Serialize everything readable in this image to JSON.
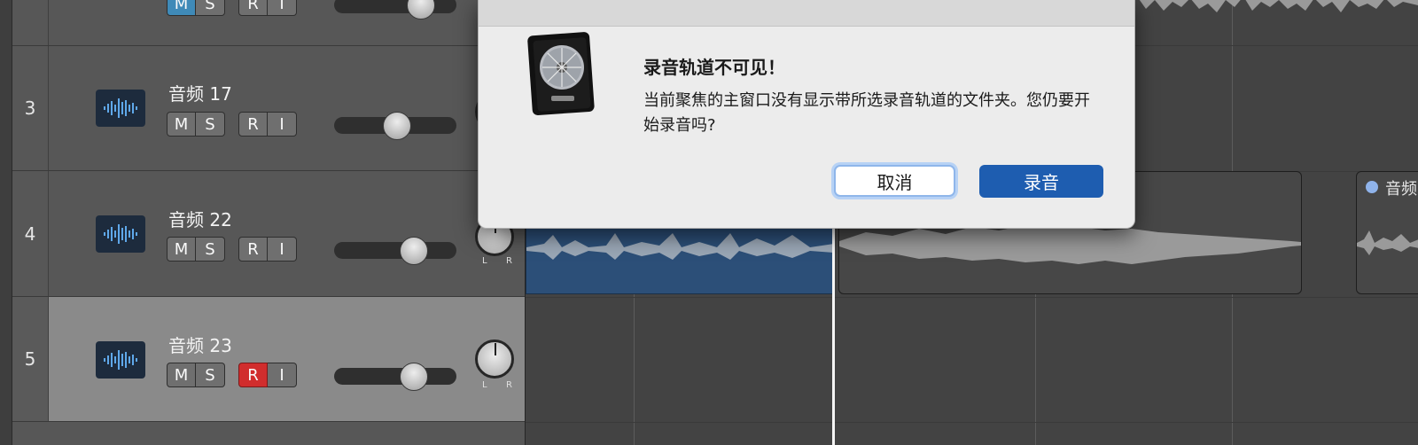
{
  "tracks": [
    {
      "number": "",
      "name": "",
      "buttons": [
        "M",
        "S",
        "R",
        "I"
      ],
      "mute_on": true,
      "record_on": false,
      "pan_labels": [
        "L",
        "R"
      ]
    },
    {
      "number": "3",
      "name": "音频 17",
      "buttons": [
        "M",
        "S",
        "R",
        "I"
      ],
      "mute_on": false,
      "record_on": false,
      "pan_labels": [
        "L",
        "R"
      ]
    },
    {
      "number": "4",
      "name": "音频 22",
      "buttons": [
        "M",
        "S",
        "R",
        "I"
      ],
      "mute_on": false,
      "record_on": false,
      "pan_labels": [
        "L",
        "R"
      ]
    },
    {
      "number": "5",
      "name": "音频 23",
      "buttons": [
        "M",
        "S",
        "R",
        "I"
      ],
      "mute_on": false,
      "record_on": true,
      "pan_labels": [
        "L",
        "R"
      ],
      "selected": true
    }
  ],
  "regions": {
    "partial_label": "音频"
  },
  "dialog": {
    "title": "录音轨道不可见！",
    "message": "当前聚焦的主窗口没有显示带所选录音轨道的文件夹。您仍要开始录音吗?",
    "cancel_label": "取消",
    "record_label": "录音",
    "icon": "logic-pro-icon"
  },
  "colors": {
    "accent": "#1e5db0",
    "record_active": "#d12d2d",
    "mute_active": "#3f8ab8",
    "region_blue": "#2c4f78"
  }
}
